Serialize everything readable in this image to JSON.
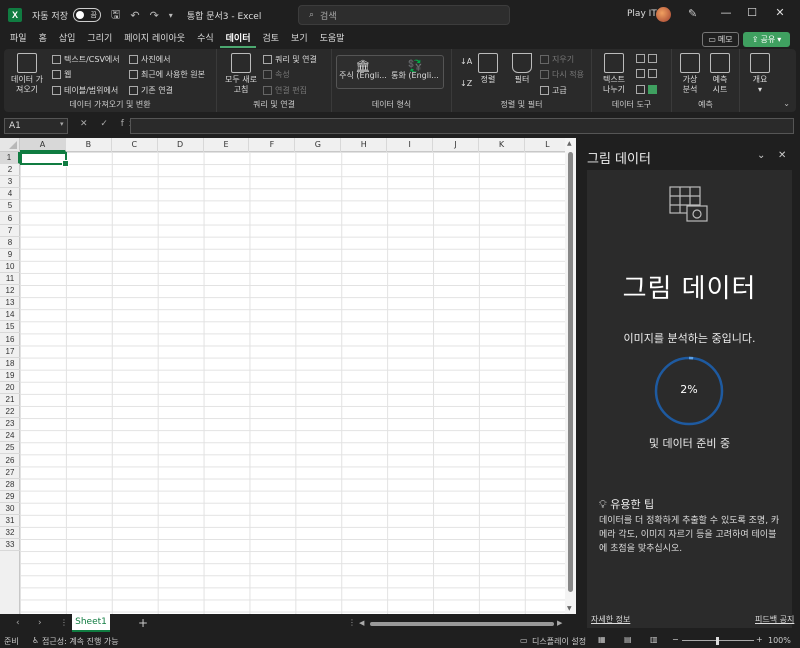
{
  "titlebar": {
    "app_icon": "X",
    "autosave": "자동 저장",
    "toggle": "끔",
    "doc_title": "통합 문서3  -  Excel",
    "search": "검색",
    "user": "Play IT"
  },
  "menu": [
    "파일",
    "홈",
    "삽입",
    "그리기",
    "페이지 레이아웃",
    "수식",
    "데이터",
    "검토",
    "보기",
    "도움말"
  ],
  "memo": "메모",
  "share": "공유",
  "ribbon": {
    "get_data": "데이터 가\n져오기",
    "from_text": "텍스트/CSV에서",
    "from_web": "웹",
    "from_table": "테이블/범위에서",
    "from_picture": "사진에서",
    "recent": "최근에 사용한 원본",
    "existing": "기존 연결",
    "group1": "데이터 가져오기 및 변환",
    "refresh": "모두 새로\n고침",
    "queries": "쿼리 및 연결",
    "props": "속성",
    "edit_links": "연결 편집",
    "group2": "쿼리 및 연결",
    "stocks": "주식 (Engli...",
    "currency": "통화 (Engli...",
    "group3": "데이터 형식",
    "sort": "정렬",
    "filter": "필터",
    "clear": "지우기",
    "reapply": "다시 적용",
    "advanced": "고급",
    "group4": "정렬 및 필터",
    "text_to_cols": "텍스트\n나누기",
    "group5": "데이터 도구",
    "what_if": "가상\n분석",
    "forecast": "예측\n시트",
    "group6": "예측",
    "outline": "개요"
  },
  "formula": {
    "namebox": "A1",
    "fx": "✕ ✓ fx"
  },
  "columns": [
    "A",
    "B",
    "C",
    "D",
    "E",
    "F",
    "G",
    "H",
    "I",
    "J",
    "K",
    "L"
  ],
  "rows": [
    "1",
    "2",
    "3",
    "4",
    "5",
    "6",
    "7",
    "8",
    "9",
    "10",
    "11",
    "12",
    "13",
    "14",
    "15",
    "16",
    "17",
    "18",
    "19",
    "20",
    "21",
    "22",
    "23",
    "24",
    "25",
    "26",
    "27",
    "28",
    "29",
    "30",
    "31",
    "32",
    "33"
  ],
  "sheet": "Sheet1",
  "status": {
    "ready": "준비",
    "access": "접근성: 계속 진행 가능",
    "display": "디스플레이 설정",
    "zoom": "100%"
  },
  "panel": {
    "title": "그림 데이터",
    "big_title": "그림 데이터",
    "analyzing": "이미지를 분석하는 중입니다.",
    "percent": "2%",
    "progress": 0.02,
    "preparing": "및 데이터 준비 중",
    "tip_head": "유용한 팁",
    "tip_body": "데이터를 더 정확하게 추출할 수 있도록 조명, 카메라 각도, 이미지 자르기 등을 고려하여 테이블에 초점을 맞추십시오.",
    "more_info": "자세한 정보",
    "feedback": "피드백 공지"
  },
  "colors": {
    "accent": "#107c41",
    "share": "#3fa060",
    "ring": "#1e5aa0"
  }
}
